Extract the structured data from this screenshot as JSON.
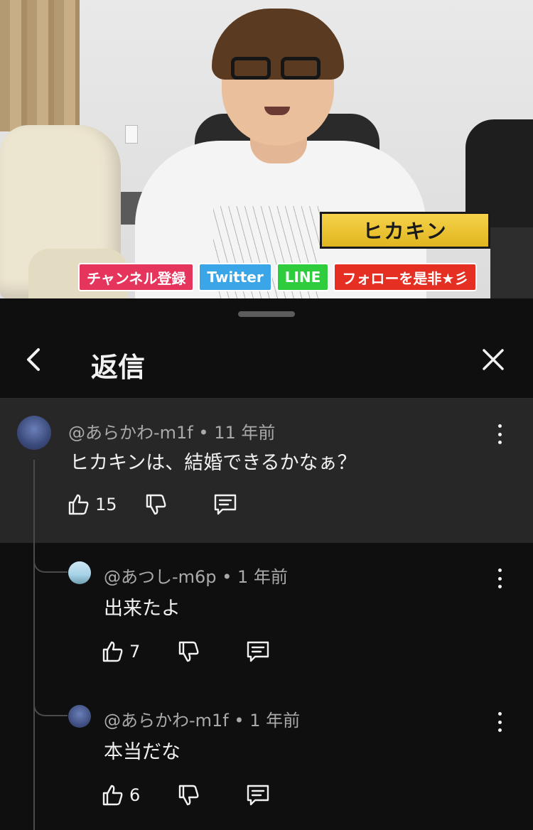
{
  "video": {
    "name_plate": "ヒカキン",
    "tags": [
      {
        "label": "チャンネル登録"
      },
      {
        "label": "Twitter"
      },
      {
        "label": "LINE"
      },
      {
        "label": "フォローを是非★彡"
      }
    ]
  },
  "header": {
    "title": "返信",
    "back_icon": "chevron-left-icon",
    "close_icon": "close-icon"
  },
  "comments": [
    {
      "author": "@あらかわ-m1f",
      "time": "11 年前",
      "text": "ヒカキンは、結婚できるかなぁ？",
      "likes": "15"
    },
    {
      "author": "@あつし-m6p",
      "time": "1 年前",
      "text": "出来たよ",
      "likes": "7"
    },
    {
      "author": "@あらかわ-m1f",
      "time": "1 年前",
      "text": "本当だな",
      "likes": "6"
    }
  ],
  "separator": "•",
  "colors": {
    "background": "#0f0f0f",
    "highlighted_comment": "#272727",
    "meta_text": "#aaaaaa",
    "primary_text": "#f1f1f1"
  }
}
